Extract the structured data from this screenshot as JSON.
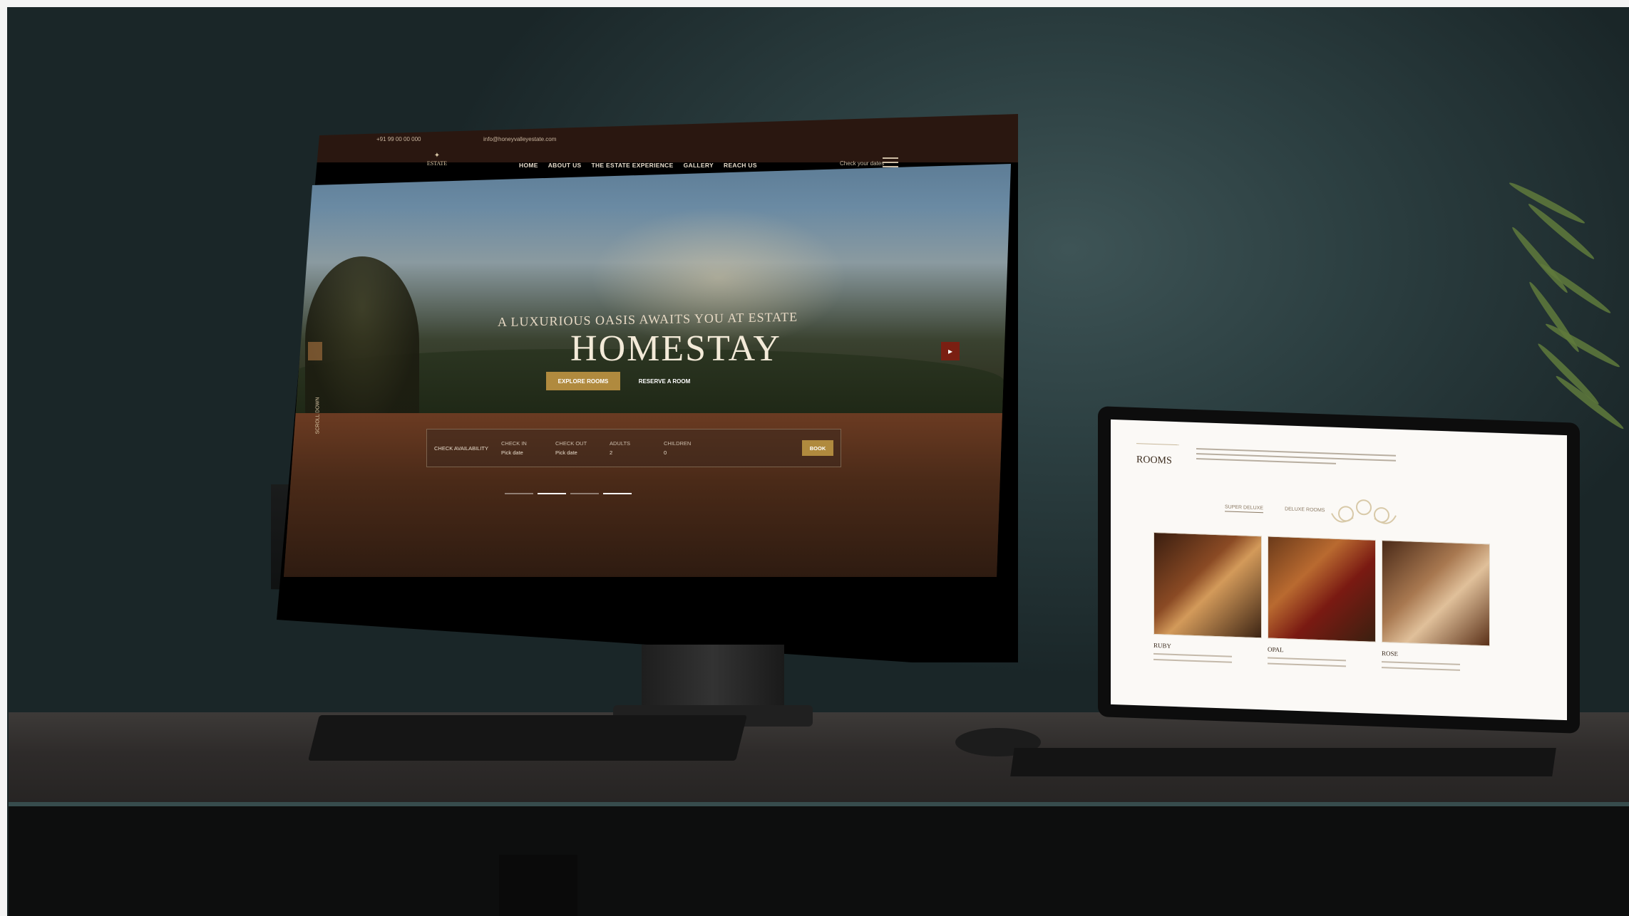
{
  "monitor": {
    "topbar_left": "+91 99 00 00 000",
    "topbar_center": "info@honeyvalleyestate.com",
    "logo_text": "ESTATE",
    "nav": [
      "HOME",
      "ABOUT US",
      "THE ESTATE EXPERIENCE",
      "GALLERY",
      "REACH US"
    ],
    "nav_right": "Check your dates",
    "tagline": "A LUXURIOUS OASIS AWAITS YOU AT ESTATE",
    "headline": "HOMESTAY",
    "btn_explore": "EXPLORE ROOMS",
    "btn_reserve": "RESERVE A ROOM",
    "side_label": "SCROLL DOWN",
    "booking": {
      "intro": "CHECK AVAILABILITY",
      "fields": [
        {
          "label": "CHECK IN",
          "value": "Pick date"
        },
        {
          "label": "CHECK OUT",
          "value": "Pick date"
        },
        {
          "label": "ADULTS",
          "value": "2"
        },
        {
          "label": "CHILDREN",
          "value": "0"
        }
      ],
      "button": "BOOK"
    }
  },
  "tablet": {
    "section_title": "ROOMS",
    "tabs": [
      "SUPER DELUXE",
      "DELUXE ROOMS"
    ],
    "rooms": [
      {
        "name": "RUBY"
      },
      {
        "name": "OPAL"
      },
      {
        "name": "ROSE"
      }
    ]
  },
  "colors": {
    "gold": "#b08a3e",
    "maroon": "#7a1f12",
    "header_brown": "#2a1710",
    "wall": "#2c3f41"
  }
}
